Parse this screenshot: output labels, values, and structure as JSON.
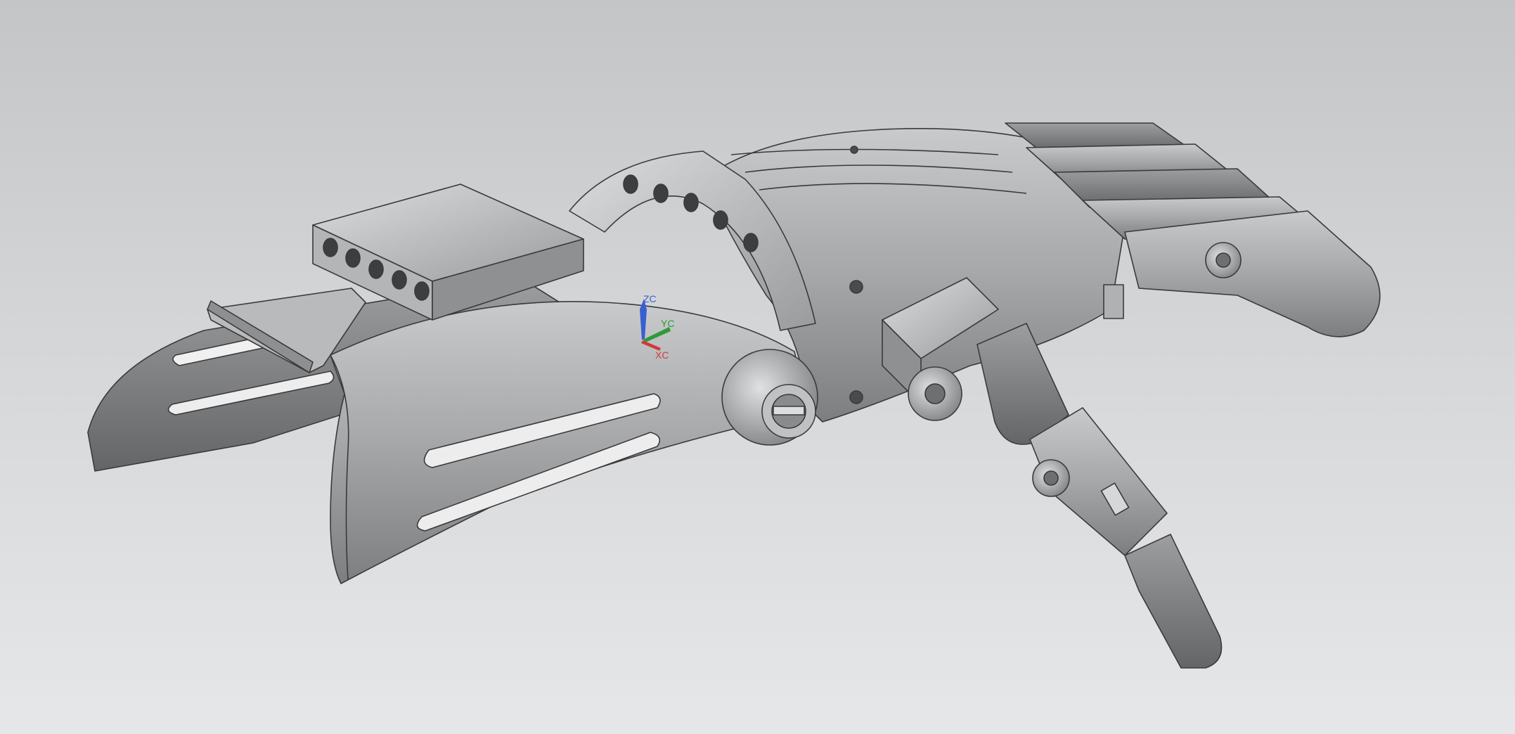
{
  "viewport": {
    "background_top": "#c4c5c7",
    "background_bottom": "#e6e7e9",
    "model_color": "#a9aaac",
    "edge_color": "#3a3a3c"
  },
  "triad": {
    "z_label": "ZC",
    "y_label": "YC",
    "x_label": "XC",
    "z_color": "#3a5fd0",
    "y_color": "#2f9a3a",
    "x_color": "#d03a3a"
  }
}
